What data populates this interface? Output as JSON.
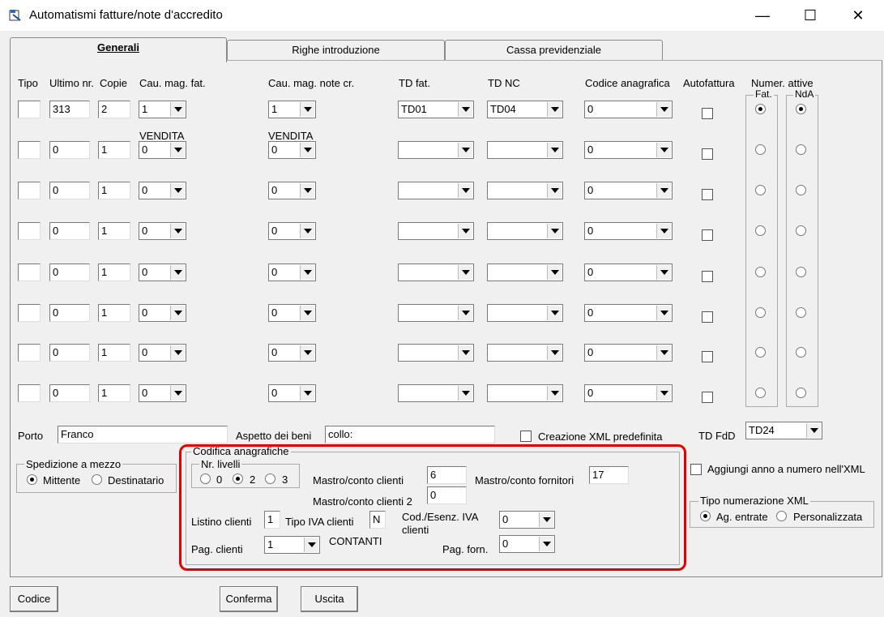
{
  "window": {
    "title": "Automatismi fatture/note d'accredito",
    "minimize": "—",
    "maximize": "☐",
    "close": "✕"
  },
  "tabs": [
    {
      "label": "Generali",
      "active": true
    },
    {
      "label": "Righe introduzione",
      "active": false
    },
    {
      "label": "Cassa previdenziale",
      "active": false
    }
  ],
  "headers": {
    "tipo": "Tipo",
    "ultimo_nr": "Ultimo nr.",
    "copie": "Copie",
    "cau_mag_fat": "Cau. mag. fat.",
    "cau_mag_note": "Cau. mag. note cr.",
    "td_fat": "TD fat.",
    "td_nc": "TD NC",
    "codice_anagrafica": "Codice anagrafica",
    "autofattura": "Autofattura",
    "numer_attive": "Numer. attive",
    "fat": "Fat.",
    "nda": "NdA"
  },
  "caption_vendita_fat": "VENDITA",
  "caption_vendita_note": "VENDITA",
  "rows": [
    {
      "tipo": "",
      "ultimo": "313",
      "copie": "2",
      "cau_fat": "1",
      "cau_note": "1",
      "td_fat": "TD01",
      "td_nc": "TD04",
      "codice": "0",
      "fat_selected": true,
      "nda_selected": true
    },
    {
      "tipo": "",
      "ultimo": "0",
      "copie": "1",
      "cau_fat": "0",
      "cau_note": "0",
      "td_fat": "",
      "td_nc": "",
      "codice": "0",
      "fat_selected": false,
      "nda_selected": false
    },
    {
      "tipo": "",
      "ultimo": "0",
      "copie": "1",
      "cau_fat": "0",
      "cau_note": "0",
      "td_fat": "",
      "td_nc": "",
      "codice": "0",
      "fat_selected": false,
      "nda_selected": false
    },
    {
      "tipo": "",
      "ultimo": "0",
      "copie": "1",
      "cau_fat": "0",
      "cau_note": "0",
      "td_fat": "",
      "td_nc": "",
      "codice": "0",
      "fat_selected": false,
      "nda_selected": false
    },
    {
      "tipo": "",
      "ultimo": "0",
      "copie": "1",
      "cau_fat": "0",
      "cau_note": "0",
      "td_fat": "",
      "td_nc": "",
      "codice": "0",
      "fat_selected": false,
      "nda_selected": false
    },
    {
      "tipo": "",
      "ultimo": "0",
      "copie": "1",
      "cau_fat": "0",
      "cau_note": "0",
      "td_fat": "",
      "td_nc": "",
      "codice": "0",
      "fat_selected": false,
      "nda_selected": false
    },
    {
      "tipo": "",
      "ultimo": "0",
      "copie": "1",
      "cau_fat": "0",
      "cau_note": "0",
      "td_fat": "",
      "td_nc": "",
      "codice": "0",
      "fat_selected": false,
      "nda_selected": false
    },
    {
      "tipo": "",
      "ultimo": "0",
      "copie": "1",
      "cau_fat": "0",
      "cau_note": "0",
      "td_fat": "",
      "td_nc": "",
      "codice": "0",
      "fat_selected": false,
      "nda_selected": false
    }
  ],
  "porto": {
    "label": "Porto",
    "value": "Franco"
  },
  "aspetto": {
    "label": "Aspetto dei beni",
    "value": "collo:"
  },
  "creazione_xml": {
    "label": "Creazione XML predefinita",
    "checked": false
  },
  "td_fdd": {
    "label": "TD FdD",
    "value": "TD24"
  },
  "spedizione": {
    "title": "Spedizione a mezzo",
    "options": [
      "Mittente",
      "Destinatario"
    ],
    "selected": 0
  },
  "codifica": {
    "title": "Codifica anagrafiche",
    "livelli_title": "Nr. livelli",
    "livelli_options": [
      "0",
      "2",
      "3"
    ],
    "livelli_selected": 1,
    "mastro_clienti_label": "Mastro/conto clienti",
    "mastro_clienti_value": "6",
    "mastro_fornitori_label": "Mastro/conto fornitori",
    "mastro_fornitori_value": "17",
    "mastro_clienti2_label": "Mastro/conto clienti 2",
    "mastro_clienti2_value": "0",
    "listino_label": "Listino clienti",
    "listino_value": "1",
    "tipo_iva_label": "Tipo IVA clienti",
    "tipo_iva_value": "N",
    "cod_esenz_label_1": "Cod./Esenz. IVA",
    "cod_esenz_label_2": "clienti",
    "cod_esenz_value": "0",
    "pag_clienti_label": "Pag. clienti",
    "pag_clienti_value": "1",
    "pag_clienti_desc": "CONTANTI",
    "pag_forn_label": "Pag. forn.",
    "pag_forn_value": "0"
  },
  "aggiungi_anno": {
    "label": "Aggiungi anno a numero nell'XML",
    "checked": false
  },
  "tipo_num_xml": {
    "title": "Tipo numerazione XML",
    "options": [
      "Ag. entrate",
      "Personalizzata"
    ],
    "selected": 0
  },
  "buttons": {
    "codice": "Codice",
    "conferma": "Conferma",
    "uscita": "Uscita"
  },
  "colors": {
    "highlight": "#e00000"
  }
}
